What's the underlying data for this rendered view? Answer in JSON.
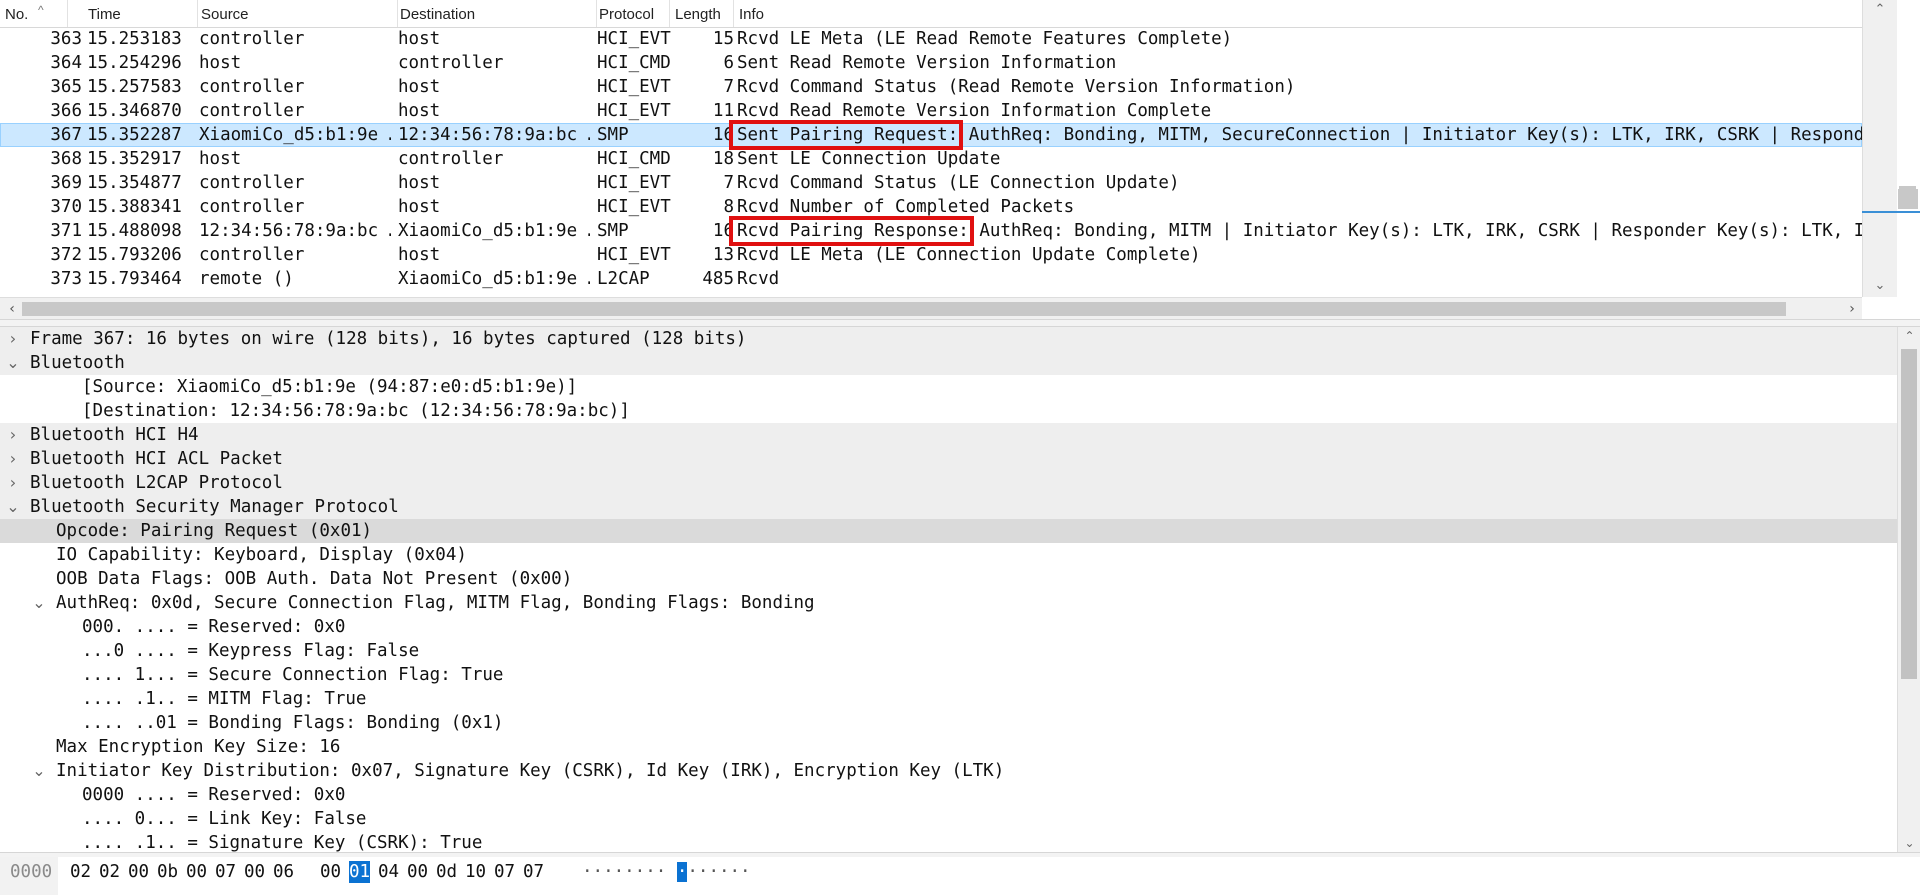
{
  "columns": {
    "no": "No.",
    "time": "Time",
    "source": "Source",
    "destination": "Destination",
    "protocol": "Protocol",
    "length": "Length",
    "info": "Info"
  },
  "sort_indicator": "^",
  "packets": [
    {
      "no": "363",
      "time": "15.253183",
      "source": "controller",
      "destination": "host",
      "protocol": "HCI_EVT",
      "length": "15",
      "info": "Rcvd LE Meta (LE Read Remote Features Complete)"
    },
    {
      "no": "364",
      "time": "15.254296",
      "source": "host",
      "destination": "controller",
      "protocol": "HCI_CMD",
      "length": "6",
      "info": "Sent Read Remote Version Information"
    },
    {
      "no": "365",
      "time": "15.257583",
      "source": "controller",
      "destination": "host",
      "protocol": "HCI_EVT",
      "length": "7",
      "info": "Rcvd Command Status (Read Remote Version Information)"
    },
    {
      "no": "366",
      "time": "15.346870",
      "source": "controller",
      "destination": "host",
      "protocol": "HCI_EVT",
      "length": "11",
      "info": "Rcvd Read Remote Version Information Complete"
    },
    {
      "no": "367",
      "time": "15.352287",
      "source": "XiaomiCo_d5:b1:9e …",
      "destination": "12:34:56:78:9a:bc …",
      "protocol": "SMP",
      "length": "16",
      "info": "Sent Pairing Request: AuthReq: Bonding, MITM, SecureConnection | Initiator Key(s): LTK, IRK, CSRK | Responder Key(s): LTK, IRK, CSRK",
      "selected": true
    },
    {
      "no": "368",
      "time": "15.352917",
      "source": "host",
      "destination": "controller",
      "protocol": "HCI_CMD",
      "length": "18",
      "info": "Sent LE Connection Update"
    },
    {
      "no": "369",
      "time": "15.354877",
      "source": "controller",
      "destination": "host",
      "protocol": "HCI_EVT",
      "length": "7",
      "info": "Rcvd Command Status (LE Connection Update)"
    },
    {
      "no": "370",
      "time": "15.388341",
      "source": "controller",
      "destination": "host",
      "protocol": "HCI_EVT",
      "length": "8",
      "info": "Rcvd Number of Completed Packets"
    },
    {
      "no": "371",
      "time": "15.488098",
      "source": "12:34:56:78:9a:bc …",
      "destination": "XiaomiCo_d5:b1:9e …",
      "protocol": "SMP",
      "length": "16",
      "info": "Rcvd Pairing Response: AuthReq: Bonding, MITM | Initiator Key(s): LTK, IRK, CSRK | Responder Key(s): LTK, IRK, CSRK"
    },
    {
      "no": "372",
      "time": "15.793206",
      "source": "controller",
      "destination": "host",
      "protocol": "HCI_EVT",
      "length": "13",
      "info": "Rcvd LE Meta (LE Connection Update Complete)"
    },
    {
      "no": "373",
      "time": "15.793464",
      "source": "remote ()",
      "destination": "XiaomiCo_d5:b1:9e …",
      "protocol": "L2CAP",
      "length": "485",
      "info": "Rcvd"
    }
  ],
  "highlight_labels": [
    "Sent Pairing Request:",
    "Rcvd Pairing Response:"
  ],
  "highlight_color": "#e01010",
  "selection_color": "#cce8ff",
  "detail_tree": [
    {
      "text": "Frame 367: 16 bytes on wire (128 bits), 16 bytes captured (128 bits)",
      "level": 0,
      "toggle": "collapsed",
      "top_level": true
    },
    {
      "text": "Bluetooth",
      "level": 0,
      "toggle": "expanded",
      "top_level": true
    },
    {
      "text": "[Source: XiaomiCo_d5:b1:9e (94:87:e0:d5:b1:9e)]",
      "level": 2,
      "toggle": "none"
    },
    {
      "text": "[Destination: 12:34:56:78:9a:bc (12:34:56:78:9a:bc)]",
      "level": 2,
      "toggle": "none"
    },
    {
      "text": "Bluetooth HCI H4",
      "level": 0,
      "toggle": "collapsed",
      "top_level": true
    },
    {
      "text": "Bluetooth HCI ACL Packet",
      "level": 0,
      "toggle": "collapsed",
      "top_level": true
    },
    {
      "text": "Bluetooth L2CAP Protocol",
      "level": 0,
      "toggle": "collapsed",
      "top_level": true
    },
    {
      "text": "Bluetooth Security Manager Protocol",
      "level": 0,
      "toggle": "expanded",
      "top_level": true
    },
    {
      "text": "Opcode: Pairing Request (0x01)",
      "level": 1,
      "toggle": "none",
      "selected": true
    },
    {
      "text": "IO Capability: Keyboard, Display (0x04)",
      "level": 1,
      "toggle": "none"
    },
    {
      "text": "OOB Data Flags: OOB Auth. Data Not Present (0x00)",
      "level": 1,
      "toggle": "none"
    },
    {
      "text": "AuthReq: 0x0d, Secure Connection Flag, MITM Flag, Bonding Flags: Bonding",
      "level": 1,
      "toggle": "expanded"
    },
    {
      "text": "000. .... = Reserved: 0x0",
      "level": 2,
      "toggle": "none"
    },
    {
      "text": "...0 .... = Keypress Flag: False",
      "level": 2,
      "toggle": "none"
    },
    {
      "text": ".... 1... = Secure Connection Flag: True",
      "level": 2,
      "toggle": "none"
    },
    {
      "text": ".... .1.. = MITM Flag: True",
      "level": 2,
      "toggle": "none"
    },
    {
      "text": ".... ..01 = Bonding Flags: Bonding (0x1)",
      "level": 2,
      "toggle": "none"
    },
    {
      "text": "Max Encryption Key Size: 16",
      "level": 1,
      "toggle": "none"
    },
    {
      "text": "Initiator Key Distribution: 0x07, Signature Key (CSRK), Id Key (IRK), Encryption Key (LTK)",
      "level": 1,
      "toggle": "expanded"
    },
    {
      "text": "0000 .... = Reserved: 0x0",
      "level": 2,
      "toggle": "none"
    },
    {
      "text": ".... 0... = Link Key: False",
      "level": 2,
      "toggle": "none"
    },
    {
      "text": ".... .1.. = Signature Key (CSRK): True",
      "level": 2,
      "toggle": "none"
    }
  ],
  "hex": {
    "offset": "0000",
    "bytes": [
      "02",
      "02",
      "00",
      "0b",
      "00",
      "07",
      "00",
      "06",
      "00",
      "01",
      "04",
      "00",
      "0d",
      "10",
      "07",
      "07"
    ],
    "selected_index": 9,
    "ascii": "········ ·······",
    "selected_ascii_index": 9
  },
  "icons": {
    "collapsed": "chevron-right-icon",
    "expanded": "chevron-down-icon",
    "scroll_up": "scroll-up-icon",
    "scroll_down": "scroll-down-icon",
    "scroll_left": "scroll-left-icon",
    "scroll_right": "scroll-right-icon"
  },
  "glyphs": {
    "collapsed": "›",
    "expanded": "⌄",
    "up": "⌃",
    "down": "⌄",
    "left": "‹",
    "right": "›"
  }
}
